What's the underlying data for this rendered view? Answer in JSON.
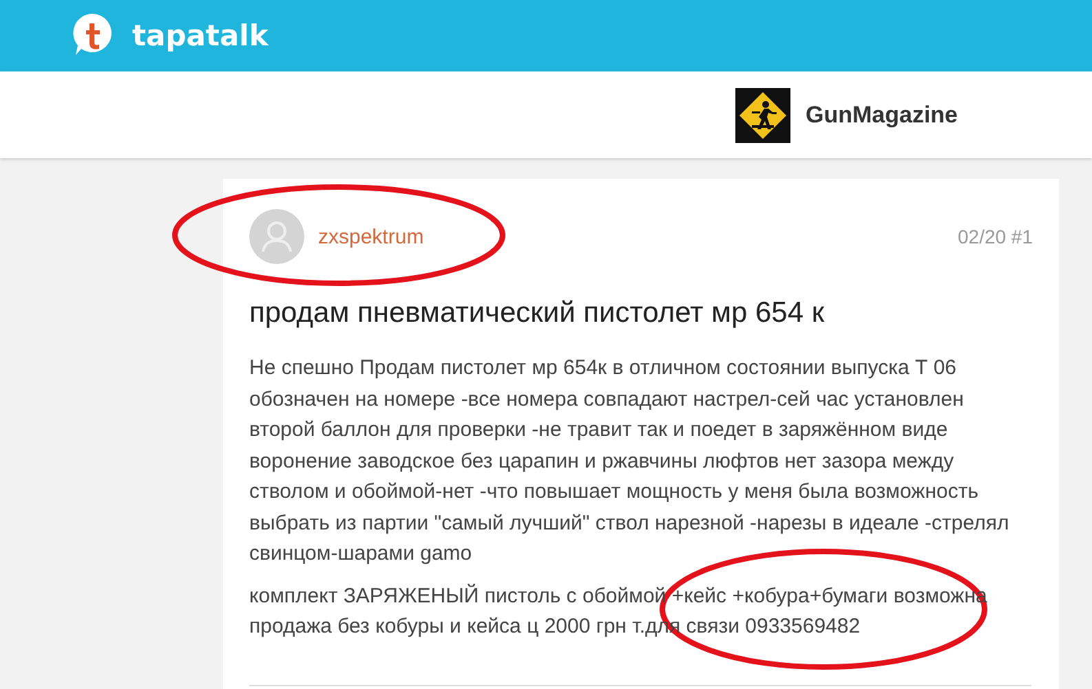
{
  "header": {
    "logo_text": "tapatalk"
  },
  "forum": {
    "name": "GunMagazine"
  },
  "post": {
    "author": "zxspektrum",
    "meta": "02/20 #1",
    "title": "продам пневматический пистолет мр 654 к",
    "paragraphs": [
      "Не спешно Продам пистолет мр 654к в отличном состоянии выпуска Т 06 обозначен на номере -все номера совпадают настрел-сей час установлен второй баллон для проверки -не травит так и поедет в заряжённом виде воронение заводское без царапин и ржавчины люфтов нет зазора между стволом и обоймой-нет -что повышает мощность у меня была возможность выбрать из партии \"самый лучший\" ствол нарезной -нарезы в идеале -стрелял свинцом-шарами gamo",
      "комплект ЗАРЯЖЕНЫЙ пистоль с обоймой +кейс +кобура+бумаги возможна продажа без кобуры и кейса ц 2000 грн т.для связи 0933569482"
    ]
  }
}
